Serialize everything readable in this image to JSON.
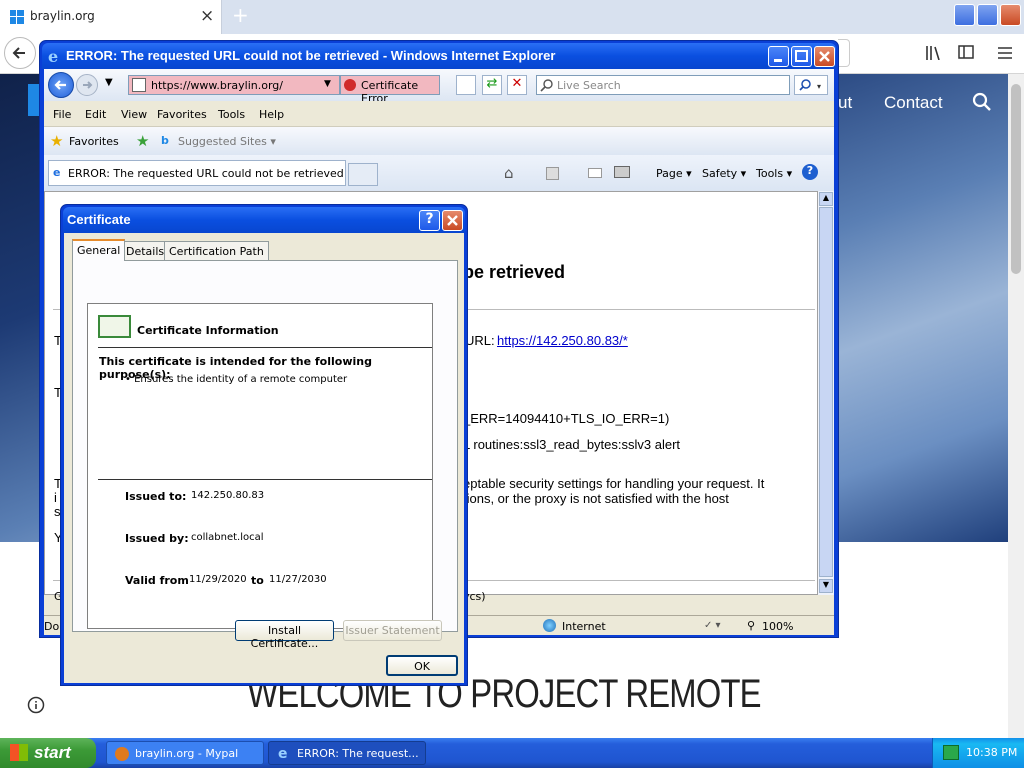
{
  "outer_browser": {
    "tab_title": "braylin.org",
    "new_tab": "+",
    "close_tab": "×"
  },
  "site": {
    "nav_partial": "ut",
    "nav_contact": "Contact",
    "welcome": "WELCOME TO PROJECT REMOTE"
  },
  "ie": {
    "title": "ERROR: The requested URL could not be retrieved - Windows Internet Explorer",
    "address": "https://www.braylin.org/",
    "cert_error": "Certificate Error",
    "search_placeholder": "Live Search",
    "menu": [
      "File",
      "Edit",
      "View",
      "Favorites",
      "Tools",
      "Help"
    ],
    "favorites_label": "Favorites",
    "suggested_sites": "Suggested Sites ▾",
    "tab_title": "ERROR: The requested URL could not be retrieved",
    "toolbar": {
      "page": "Page ▾",
      "safety": "Safety ▾",
      "tools": "Tools ▾"
    },
    "content": {
      "heading_visible": "be retrieved",
      "url_prefix": "URL: ",
      "url_link": "https://142.250.80.83/*",
      "err_line1": "_ERR=14094410+TLS_IO_ERR=1)",
      "err_line2": "L routines:ssl3_read_bytes:sslv3 alert",
      "para_line1": "eptable security settings for handling your request. It",
      "para_line2": "tions, or the proxy is not satisfied with the host",
      "footer_frag": "vcs)",
      "left_t1": "T",
      "left_t2": "T",
      "left_t3": "T",
      "left_i": "i",
      "left_s": "s",
      "left_y": "Y",
      "left_g": "G"
    },
    "status": {
      "left_frag": "Don",
      "zone": "Internet",
      "zoom": "100%"
    }
  },
  "cert_dialog": {
    "title": "Certificate",
    "tabs": [
      "General",
      "Details",
      "Certification Path"
    ],
    "info_heading": "Certificate Information",
    "purpose_heading": "This certificate is intended for the following purpose(s):",
    "purpose_item": "• Ensures the identity of a remote computer",
    "issued_to_label": "Issued to:",
    "issued_to": "142.250.80.83",
    "issued_by_label": "Issued by:",
    "issued_by": "collabnet.local",
    "valid_from_label": "Valid from",
    "valid_from": "11/29/2020",
    "valid_to_label": "to",
    "valid_to": "11/27/2030",
    "install_btn": "Install Certificate...",
    "issuer_btn": "Issuer Statement",
    "ok_btn": "OK"
  },
  "taskbar": {
    "start": "start",
    "tasks": [
      "braylin.org - Mypal",
      "ERROR: The request..."
    ],
    "clock": "10:38 PM"
  },
  "colors": {
    "xp_blue": "#0a4fe0",
    "taskbar": "#245edb",
    "start_green": "#3c9a37",
    "cert_error_bg": "#f2b8c0",
    "link": "#0000cc"
  }
}
